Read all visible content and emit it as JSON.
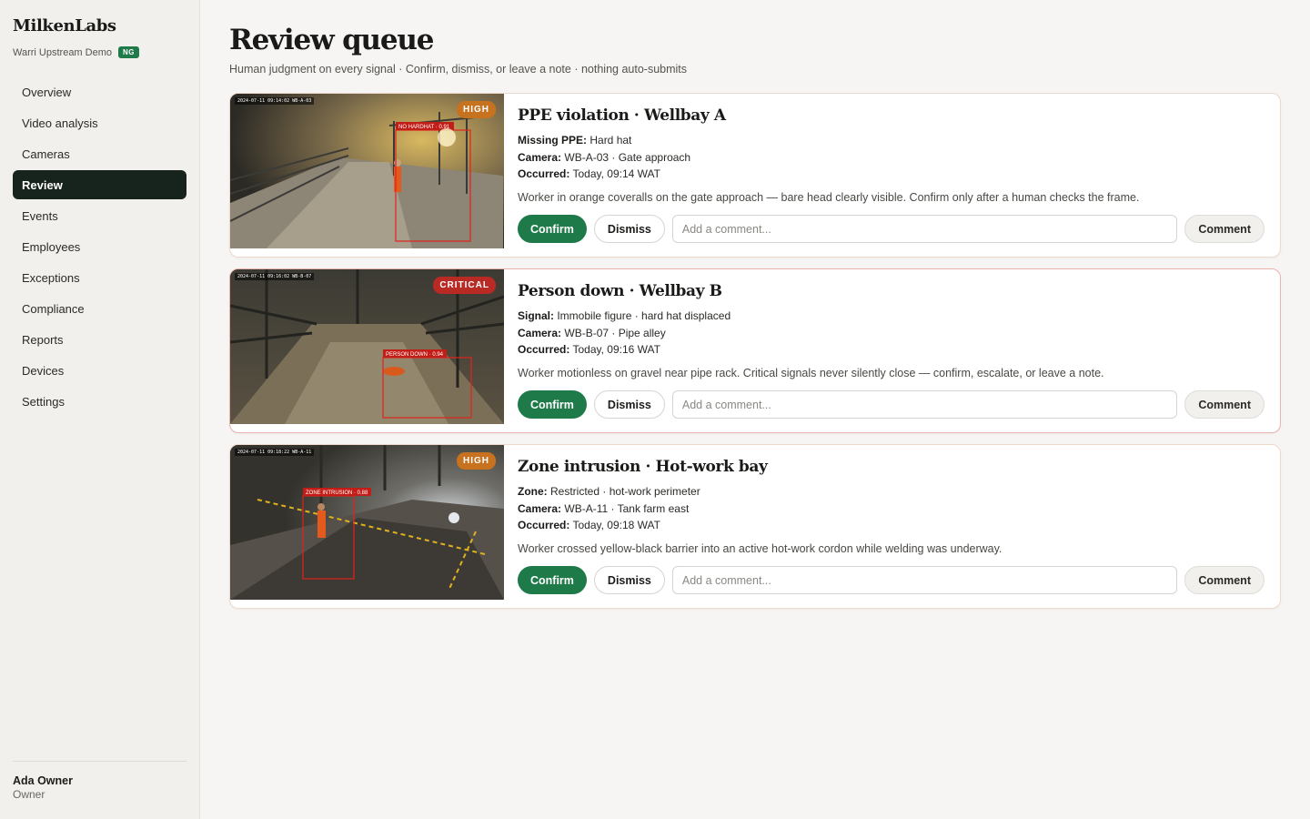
{
  "sidebar": {
    "brand": "MilkenLabs",
    "org": "Warri Upstream Demo",
    "org_badge": "NG",
    "items": [
      {
        "label": "Overview"
      },
      {
        "label": "Video analysis"
      },
      {
        "label": "Cameras"
      },
      {
        "label": "Review",
        "active": true
      },
      {
        "label": "Events"
      },
      {
        "label": "Employees"
      },
      {
        "label": "Exceptions"
      },
      {
        "label": "Compliance"
      },
      {
        "label": "Reports"
      },
      {
        "label": "Devices"
      },
      {
        "label": "Settings"
      }
    ],
    "user": {
      "name": "Ada Owner",
      "role": "Owner"
    }
  },
  "page": {
    "title": "Review queue",
    "subtitle": "Human judgment on every signal · Confirm, dismiss, or leave a note · nothing auto-submits"
  },
  "colors": {
    "accent": "#1f7a49",
    "high": "#c6721f",
    "critical": "#b92a24",
    "nav_active": "#17241d"
  },
  "cards": [
    {
      "severity": "HIGH",
      "thumb_timestamp": "2024-07-11 09:14:02  WB-A-03",
      "detection_label": "NO HARDHAT · 0.91",
      "title": "PPE violation · Wellbay A",
      "f1_label": "Missing PPE:",
      "f1_value": " Hard hat",
      "f2_label": "Camera:",
      "f2_value": " WB-A-03 · Gate approach",
      "f3_label": "Occurred:",
      "f3_value": " Today, 09:14 WAT",
      "description": "Worker in orange coveralls on the gate approach — bare head clearly visible. Confirm only after a human checks the frame.",
      "confirm": "Confirm",
      "dismiss": "Dismiss",
      "comment_placeholder": "Add a comment...",
      "comment_button": "Comment"
    },
    {
      "severity": "CRITICAL",
      "thumb_timestamp": "2024-07-11 09:16:02  WB-B-07",
      "detection_label": "PERSON DOWN · 0.94",
      "title": "Person down · Wellbay B",
      "f1_label": "Signal:",
      "f1_value": " Immobile figure · hard hat displaced",
      "f2_label": "Camera:",
      "f2_value": " WB-B-07 · Pipe alley",
      "f3_label": "Occurred:",
      "f3_value": " Today, 09:16 WAT",
      "description": "Worker motionless on gravel near pipe rack. Critical signals never silently close — confirm, escalate, or leave a note.",
      "confirm": "Confirm",
      "dismiss": "Dismiss",
      "comment_placeholder": "Add a comment...",
      "comment_button": "Comment"
    },
    {
      "severity": "HIGH",
      "thumb_timestamp": "2024-07-11 09:18:22  WB-A-11",
      "detection_label": "ZONE INTRUSION · 0.88",
      "title": "Zone intrusion · Hot-work bay",
      "f1_label": "Zone:",
      "f1_value": " Restricted · hot-work perimeter",
      "f2_label": "Camera:",
      "f2_value": " WB-A-11 · Tank farm east",
      "f3_label": "Occurred:",
      "f3_value": " Today, 09:18 WAT",
      "description": "Worker crossed yellow-black barrier into an active hot-work cordon while welding was underway.",
      "confirm": "Confirm",
      "dismiss": "Dismiss",
      "comment_placeholder": "Add a comment...",
      "comment_button": "Comment"
    }
  ]
}
